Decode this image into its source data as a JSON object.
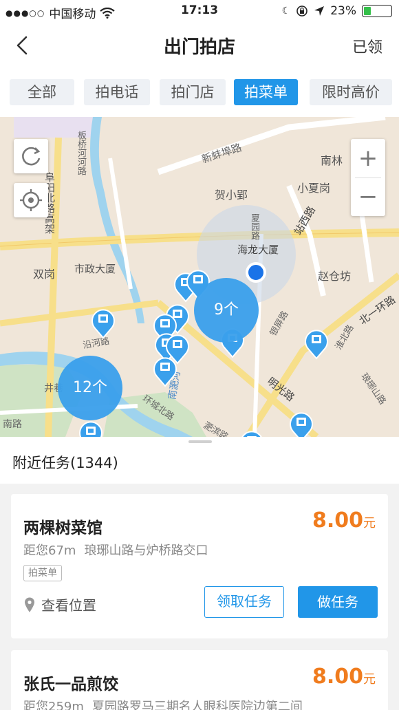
{
  "status_bar": {
    "carrier": "中国移动",
    "time": "17:13",
    "battery": "23%"
  },
  "nav": {
    "title": "出门拍店",
    "right_link": "已领"
  },
  "tabs": [
    {
      "label": "全部",
      "active": false
    },
    {
      "label": "拍电话",
      "active": false
    },
    {
      "label": "拍门店",
      "active": false
    },
    {
      "label": "拍菜单",
      "active": true
    },
    {
      "label": "限时高价",
      "active": false
    }
  ],
  "map": {
    "zoom_in": "+",
    "zoom_out": "−",
    "labels": {
      "xinbeifu_road": "新蚌埠路",
      "nanlin": "南林",
      "helixiaoying": "贺小郢",
      "xiaoxiagang": "小夏岗",
      "xiayuan_road": "夏园路",
      "fuyang_north_elevated": "阜阳北路高架",
      "banqiaohe_road": "板桥河河路",
      "haolong_tower": "海龙大厦",
      "zhanxi_road": "站西路",
      "shuanggang": "双岗",
      "shizheng_tower": "市政大厦",
      "zhaocangfang": "赵仓坊",
      "beiyi_ring": "北一环路",
      "yinping_road": "银屏路",
      "huaibei_road": "淮北路",
      "langya_road": "琅琊山路",
      "mingguang_road": "明光路",
      "yanhe_road": "沿河路",
      "nanfei_river": "南淝河",
      "huancheng_north": "环城北路",
      "jingshang": "井巷",
      "feibin_road": "淝滨路",
      "nanlu": "南路"
    },
    "clusters": [
      {
        "count_label": "9个"
      },
      {
        "count_label": "12个"
      }
    ]
  },
  "nearby": {
    "title": "附近任务(1344)"
  },
  "tasks": [
    {
      "name": "两棵树菜馆",
      "price": "8.00",
      "unit": "元",
      "distance": "距您67m",
      "address": "琅琊山路与炉桥路交口",
      "tag": "拍菜单",
      "view_location": "查看位置",
      "claim_button": "领取任务",
      "do_button": "做任务"
    },
    {
      "name": "张氏一品煎饺",
      "price": "8.00",
      "unit": "元",
      "distance": "距您259m",
      "address": "夏园路罗马三期名人眼科医院边第二间"
    }
  ]
}
